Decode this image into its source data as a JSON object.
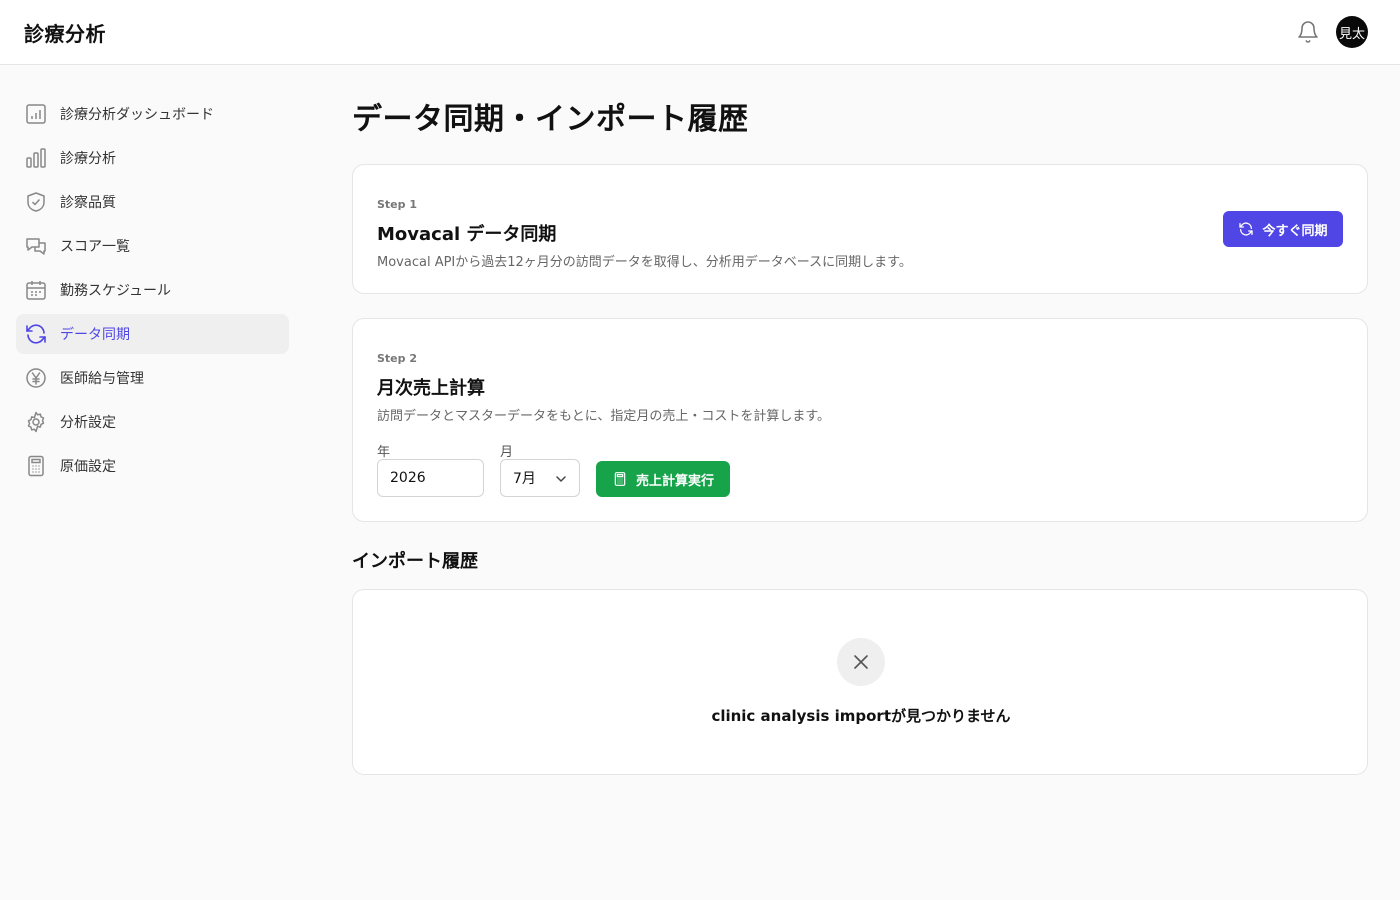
{
  "header": {
    "app_title": "診療分析",
    "bell_icon": "bell-icon",
    "avatar_text": "見太"
  },
  "sidebar": {
    "items": [
      {
        "label": "診療分析ダッシュボード",
        "icon": "bar-chart-square-icon"
      },
      {
        "label": "診療分析",
        "icon": "bar-chart-icon"
      },
      {
        "label": "診察品質",
        "icon": "shield-check-icon"
      },
      {
        "label": "スコア一覧",
        "icon": "chat-bubbles-icon"
      },
      {
        "label": "勤務スケジュール",
        "icon": "calendar-icon"
      },
      {
        "label": "データ同期",
        "icon": "refresh-icon",
        "active": true
      },
      {
        "label": "医師給与管理",
        "icon": "yen-circle-icon"
      },
      {
        "label": "分析設定",
        "icon": "gear-icon"
      },
      {
        "label": "原価設定",
        "icon": "calculator-icon"
      }
    ],
    "active_color": "#4f46e5"
  },
  "main": {
    "page_title": "データ同期・インポート履歴",
    "step1": {
      "step_label": "Step 1",
      "title": "Movacal データ同期",
      "description": "Movacal APIから過去12ヶ月分の訪問データを取得し、分析用データベースに同期します。",
      "button_label": "今すぐ同期",
      "button_color": "#4f46e5"
    },
    "step2": {
      "step_label": "Step 2",
      "title": "月次売上計算",
      "description": "訪問データとマスターデータをもとに、指定月の売上・コストを計算します。",
      "year_label": "年",
      "year_value": "2026",
      "month_label": "月",
      "month_value": "7月",
      "button_label": "売上計算実行",
      "button_color": "#16a34a"
    },
    "import_history": {
      "title": "インポート履歴",
      "empty_icon": "x-icon",
      "empty_message": "clinic analysis importが見つかりません"
    }
  }
}
